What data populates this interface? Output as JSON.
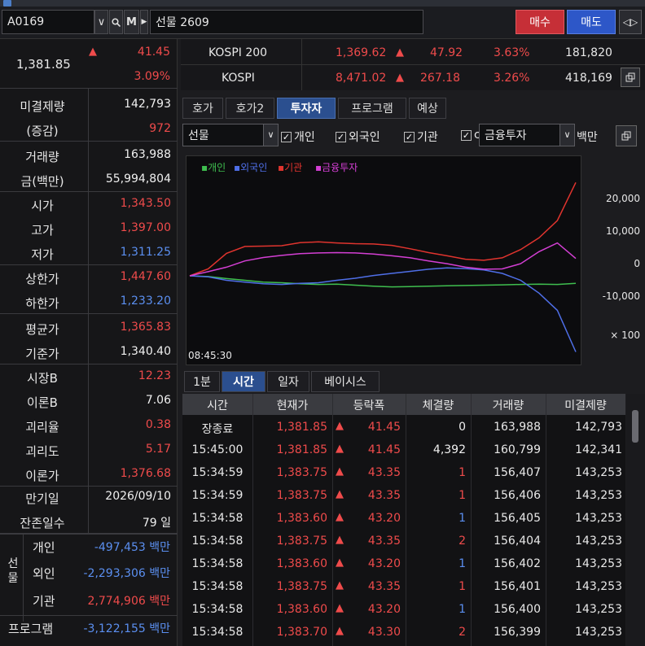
{
  "toolbar": {
    "code": "A0169",
    "name": "선물 2609",
    "buy_label": "매수",
    "sell_label": "매도"
  },
  "left": {
    "price": "1,381.85",
    "change": "41.45",
    "change_pct": "3.09%",
    "rows": [
      {
        "label": "미결제량",
        "value": "142,793"
      },
      {
        "label": "(증감)",
        "value": "972"
      },
      {
        "label": "거래량",
        "value": "163,988"
      },
      {
        "label": "금(백만)",
        "value": "55,994,804"
      },
      {
        "label": "시가",
        "value": "1,343.50"
      },
      {
        "label": "고가",
        "value": "1,397.00"
      },
      {
        "label": "저가",
        "value": "1,311.25"
      },
      {
        "label": "상한가",
        "value": "1,447.60"
      },
      {
        "label": "하한가",
        "value": "1,233.20"
      },
      {
        "label": "평균가",
        "value": "1,365.83"
      },
      {
        "label": "기준가",
        "value": "1,340.40"
      },
      {
        "label": "시장B",
        "value": "12.23"
      },
      {
        "label": "이론B",
        "value": "7.06"
      },
      {
        "label": "괴리율",
        "value": "0.38"
      },
      {
        "label": "괴리도",
        "value": "5.17"
      },
      {
        "label": "이론가",
        "value": "1,376.68"
      },
      {
        "label": "만기일",
        "value": "2026/09/10"
      },
      {
        "label": "잔존일수",
        "value": "79 일"
      }
    ],
    "futures_group": "선물",
    "investors": [
      {
        "label": "개인",
        "value": "-497,453 백만"
      },
      {
        "label": "외인",
        "value": "-2,293,306 백만"
      },
      {
        "label": "기관",
        "value": "2,774,906 백만"
      }
    ],
    "program": {
      "label": "프로그램",
      "value": "-3,122,155 백만"
    }
  },
  "indices": [
    {
      "name": "KOSPI 200",
      "value": "1,369.62",
      "change": "47.92",
      "pct": "3.63%",
      "vol": "181,820"
    },
    {
      "name": "KOSPI",
      "value": "8,471.02",
      "change": "267.18",
      "pct": "3.26%",
      "vol": "418,169"
    }
  ],
  "tabs": [
    "호가",
    "호가2",
    "투자자",
    "프로그램",
    "예상"
  ],
  "filter": {
    "select": "선물",
    "checks": [
      "개인",
      "외국인",
      "기관",
      "c"
    ],
    "select2": "금융투자",
    "unit": "백만"
  },
  "chart_data": {
    "type": "line",
    "legend": [
      {
        "name": "개인",
        "color": "#3fbf4f"
      },
      {
        "name": "외국인",
        "color": "#4f6fe8"
      },
      {
        "name": "기관",
        "color": "#e0342e"
      },
      {
        "name": "금융투자",
        "color": "#d43fd4"
      }
    ],
    "y_ticks": [
      "20,000",
      "10,000",
      "0",
      "-10,000",
      "× 100"
    ],
    "x_label": "08:45:30",
    "ylim": [
      -20000,
      28000
    ],
    "series": [
      {
        "name": "개인",
        "values": [
          0,
          -200,
          -800,
          -1300,
          -1800,
          -2000,
          -2300,
          -2500,
          -2400,
          -2700,
          -3000,
          -3200,
          -3100,
          -3000,
          -2900,
          -2800,
          -2700,
          -2600,
          -2500,
          -2400,
          -2500,
          -2200
        ]
      },
      {
        "name": "외국인",
        "values": [
          0,
          -300,
          -1300,
          -1800,
          -2300,
          -2500,
          -2200,
          -2000,
          -1300,
          -700,
          100,
          700,
          1300,
          1900,
          2300,
          2100,
          1700,
          700,
          -1300,
          -5000,
          -10000,
          -22000
        ]
      },
      {
        "name": "기관",
        "values": [
          0,
          2000,
          6500,
          8500,
          8600,
          8700,
          9600,
          9800,
          9500,
          9300,
          9200,
          8800,
          7800,
          6700,
          5800,
          4800,
          4500,
          5200,
          7600,
          11000,
          16000,
          27000
        ]
      },
      {
        "name": "금융투자",
        "values": [
          0,
          1200,
          2500,
          4300,
          5300,
          5900,
          6400,
          6600,
          6700,
          6600,
          6300,
          5800,
          5200,
          4300,
          3500,
          2500,
          1900,
          2000,
          3500,
          7000,
          9500,
          5000
        ]
      }
    ]
  },
  "bottom_tabs": [
    "1분",
    "시간",
    "일자",
    "베이시스"
  ],
  "table": {
    "headers": [
      "시간",
      "현재가",
      "등락폭",
      "체결량",
      "거래량",
      "미결제량"
    ],
    "rows": [
      [
        "장종료",
        "1,381.85",
        "41.45",
        "0",
        "163,988",
        "142,793"
      ],
      [
        "15:45:00",
        "1,381.85",
        "41.45",
        "4,392",
        "160,799",
        "142,341"
      ],
      [
        "15:34:59",
        "1,383.75",
        "43.35",
        "1",
        "156,407",
        "143,253"
      ],
      [
        "15:34:59",
        "1,383.75",
        "43.35",
        "1",
        "156,406",
        "143,253"
      ],
      [
        "15:34:58",
        "1,383.60",
        "43.20",
        "1",
        "156,405",
        "143,253"
      ],
      [
        "15:34:58",
        "1,383.75",
        "43.35",
        "2",
        "156,404",
        "143,253"
      ],
      [
        "15:34:58",
        "1,383.60",
        "43.20",
        "1",
        "156,402",
        "143,253"
      ],
      [
        "15:34:58",
        "1,383.75",
        "43.35",
        "1",
        "156,401",
        "143,253"
      ],
      [
        "15:34:58",
        "1,383.60",
        "43.20",
        "1",
        "156,400",
        "143,253"
      ],
      [
        "15:34:58",
        "1,383.70",
        "43.30",
        "2",
        "156,399",
        "143,253"
      ]
    ]
  },
  "row_colors": [
    "white",
    "white",
    "red",
    "red",
    "blue",
    "red",
    "blue",
    "red",
    "blue",
    "red"
  ]
}
